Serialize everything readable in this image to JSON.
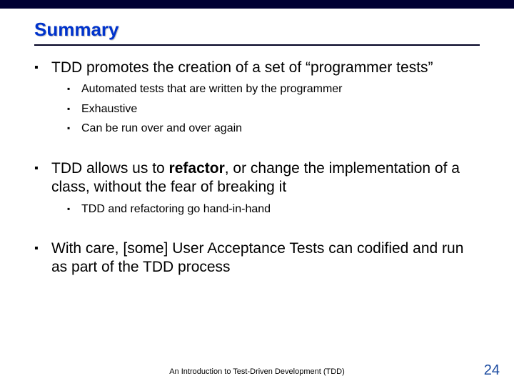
{
  "title": "Summary",
  "bullets": {
    "b1": "TDD promotes the creation of a set of “programmer tests”",
    "b1s1": "Automated tests that are written by the programmer",
    "b1s2": "Exhaustive",
    "b1s3": "Can be run over and over again",
    "b2a": "TDD allows us to ",
    "b2bold": "refactor",
    "b2b": ", or change the implementation of a class, without the fear of breaking it",
    "b2s1": "TDD and refactoring go hand-in-hand",
    "b3": "With care, [some] User Acceptance Tests can codified and run as part of the TDD process"
  },
  "footer": "An Introduction to Test-Driven Development (TDD)",
  "page": "24"
}
